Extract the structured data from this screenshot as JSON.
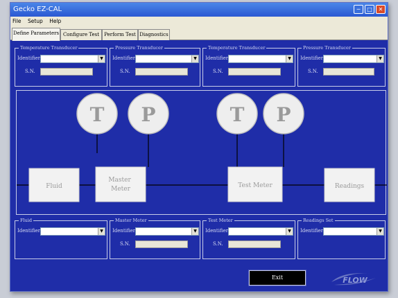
{
  "window": {
    "title": "Gecko EZ-CAL",
    "controls": [
      "minimize",
      "maximize",
      "close"
    ]
  },
  "menu": [
    "File",
    "Setup",
    "Help"
  ],
  "tabs": [
    {
      "label": "Define Parameters",
      "active": true
    },
    {
      "label": "Configure Test",
      "active": false
    },
    {
      "label": "Perform Test",
      "active": false
    },
    {
      "label": "Diagnostics",
      "active": false
    }
  ],
  "top_groups": [
    {
      "title": "Temperature Transducer",
      "identifier_label": "Identifier",
      "sn_label": "S.N."
    },
    {
      "title": "Pressure Transducer",
      "identifier_label": "Identifier",
      "sn_label": "S.N."
    },
    {
      "title": "Temperature Transducer",
      "identifier_label": "Identifier",
      "sn_label": "S.N."
    },
    {
      "title": "Pressure Transducer",
      "identifier_label": "Identifier",
      "sn_label": "S.N."
    }
  ],
  "diagram": {
    "circles": [
      "T",
      "P",
      "T",
      "P"
    ],
    "boxes": [
      "Fluid",
      "Master Meter",
      "Test Meter",
      "Readings"
    ]
  },
  "bottom_groups": [
    {
      "title": "Fluid",
      "identifier_label": "Identifier"
    },
    {
      "title": "Master Meter",
      "identifier_label": "Identifier",
      "sn_label": "S.N."
    },
    {
      "title": "Test Meter",
      "identifier_label": "Identifier",
      "sn_label": "S.N."
    },
    {
      "title": "Readings Set",
      "identifier_label": "Identifier"
    }
  ],
  "exit_label": "Exit",
  "logo_text": "FLOW",
  "colors": {
    "background": "#1f2da8",
    "title_bar": "#2a58d2",
    "panel_border": "#c8cde8"
  }
}
